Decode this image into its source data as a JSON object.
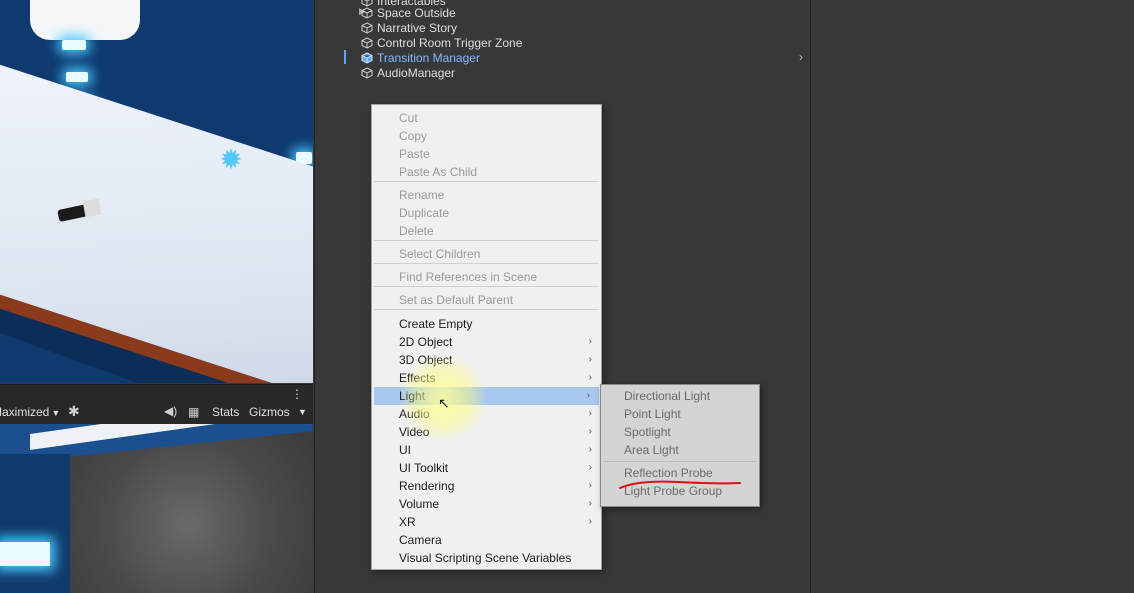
{
  "game_toolbar": {
    "maximized_label": "Maximized",
    "stats_label": "Stats",
    "gizmos_label": "Gizmos"
  },
  "hierarchy": {
    "rows": [
      {
        "label": "Interactables",
        "selected": false
      },
      {
        "label": "Space Outside",
        "selected": false
      },
      {
        "label": "Narrative Story",
        "selected": false
      },
      {
        "label": "Control Room Trigger Zone",
        "selected": false
      },
      {
        "label": "Transition Manager",
        "selected": true
      },
      {
        "label": "AudioManager",
        "selected": false
      }
    ]
  },
  "context_menu": {
    "items": [
      {
        "label": "Cut",
        "disabled": true
      },
      {
        "label": "Copy",
        "disabled": true
      },
      {
        "label": "Paste",
        "disabled": true
      },
      {
        "label": "Paste As Child",
        "disabled": true
      },
      {
        "label": "Rename",
        "disabled": true
      },
      {
        "label": "Duplicate",
        "disabled": true
      },
      {
        "label": "Delete",
        "disabled": true
      },
      {
        "label": "Select Children",
        "disabled": true
      },
      {
        "label": "Find References in Scene",
        "disabled": true
      },
      {
        "label": "Set as Default Parent",
        "disabled": true
      },
      {
        "label": "Create Empty",
        "disabled": false
      },
      {
        "label": "2D Object",
        "disabled": false,
        "submenu": true
      },
      {
        "label": "3D Object",
        "disabled": false,
        "submenu": true
      },
      {
        "label": "Effects",
        "disabled": false,
        "submenu": true
      },
      {
        "label": "Light",
        "disabled": false,
        "submenu": true,
        "highlighted": true
      },
      {
        "label": "Audio",
        "disabled": false,
        "submenu": true
      },
      {
        "label": "Video",
        "disabled": false,
        "submenu": true
      },
      {
        "label": "UI",
        "disabled": false,
        "submenu": true
      },
      {
        "label": "UI Toolkit",
        "disabled": false,
        "submenu": true
      },
      {
        "label": "Rendering",
        "disabled": false,
        "submenu": true
      },
      {
        "label": "Volume",
        "disabled": false,
        "submenu": true
      },
      {
        "label": "XR",
        "disabled": false,
        "submenu": true
      },
      {
        "label": "Camera",
        "disabled": false
      },
      {
        "label": "Visual Scripting Scene Variables",
        "disabled": false
      }
    ],
    "submenu_arrow": "›"
  },
  "light_submenu": {
    "items": [
      {
        "label": "Directional Light"
      },
      {
        "label": "Point Light"
      },
      {
        "label": "Spotlight"
      },
      {
        "label": "Area Light"
      },
      {
        "label": "Reflection Probe",
        "annotated": true
      },
      {
        "label": "Light Probe Group"
      }
    ]
  },
  "colors": {
    "panel_bg": "#383838",
    "selected_text": "#7fb9ff",
    "menu_bg": "#f0f0f0",
    "menu_highlight": "#a8c8f0",
    "annotation_red": "#e01010"
  },
  "icons": {
    "hierarchy_object": "cube-icon",
    "scene_light": "light-bulb-icon",
    "game_debug": "bug-icon",
    "game_audio": "speaker-icon",
    "game_stats": "grid-icon"
  }
}
